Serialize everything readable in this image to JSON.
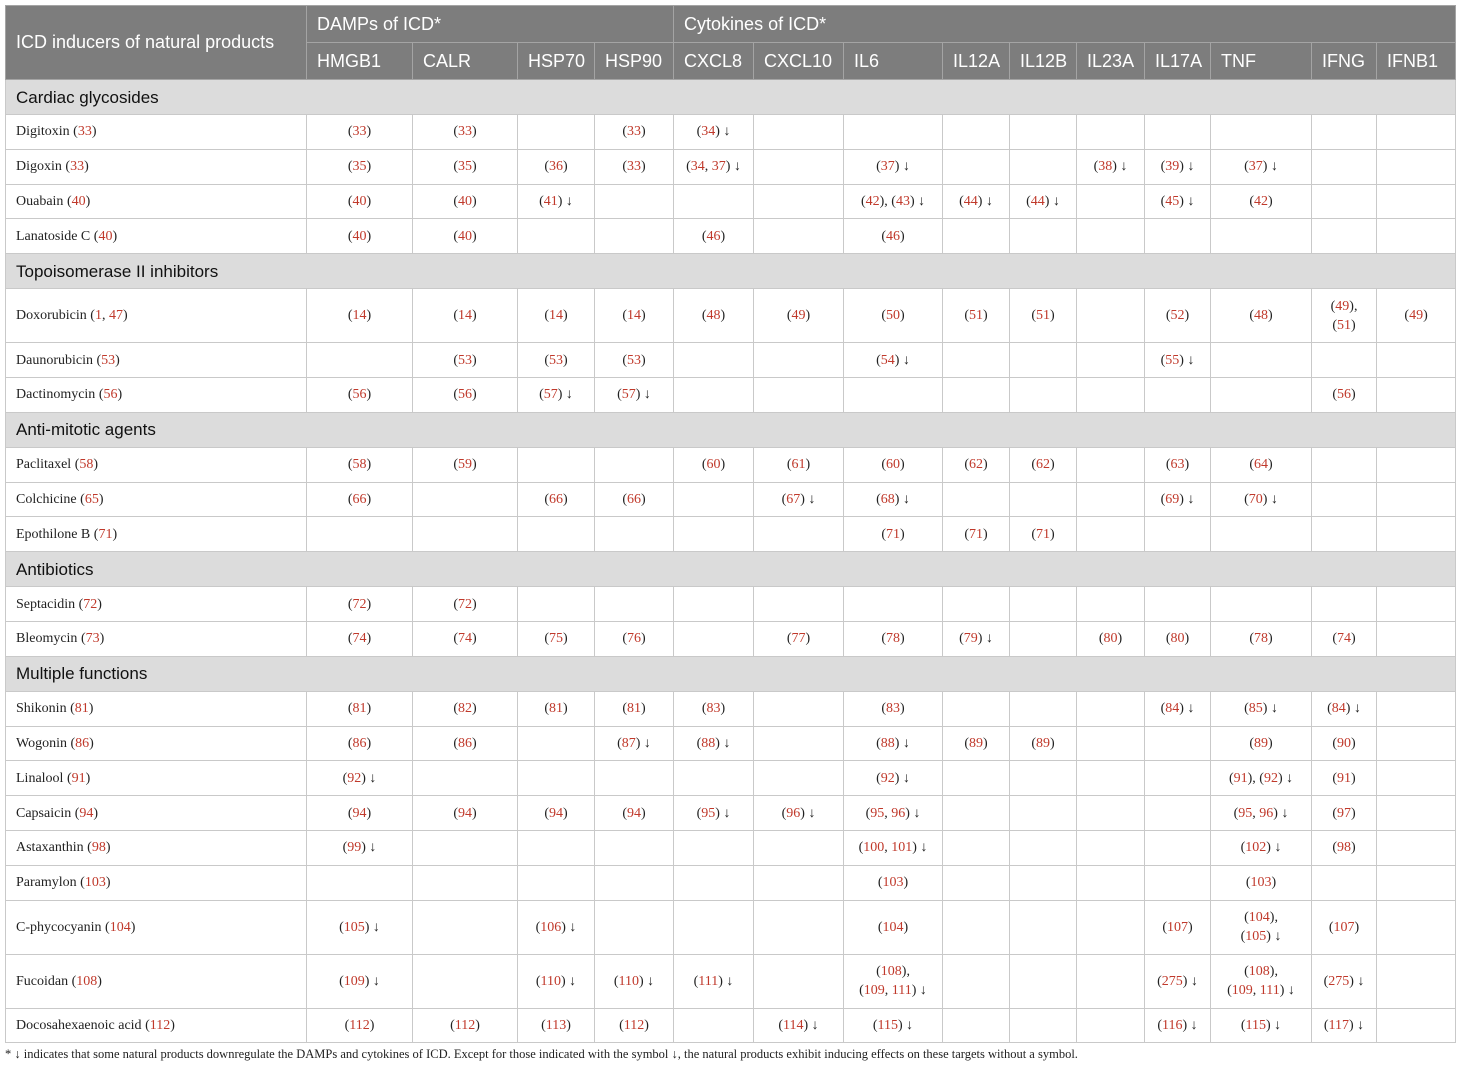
{
  "header": {
    "corner": "ICD inducers of natural products",
    "group_damps": "DAMPs of ICD*",
    "group_cytokines": "Cytokines of ICD*",
    "columns": [
      "HMGB1",
      "CALR",
      "HSP70",
      "HSP90",
      "CXCL8",
      "CXCL10",
      "IL6",
      "IL12A",
      "IL12B",
      "IL23A",
      "IL17A",
      "TNF",
      "IFNG",
      "IFNB1"
    ]
  },
  "colors": {
    "header_bg": "#7d7d7d",
    "group_bg": "#dcdcdc",
    "reference": "#c0392b",
    "grid": "#c9c9c9"
  },
  "sections": [
    {
      "title": "Cardiac glycosides",
      "rows": [
        {
          "name": "Digitoxin",
          "ref": "33",
          "cells": [
            "33",
            "33",
            "",
            "33",
            "34 ↓",
            "",
            "",
            "",
            "",
            "",
            "",
            "",
            "",
            ""
          ]
        },
        {
          "name": "Digoxin",
          "ref": "33",
          "cells": [
            "35",
            "35",
            "36",
            "33",
            "34, 37 ↓",
            "",
            "37 ↓",
            "",
            "",
            "38 ↓",
            "39 ↓",
            "37 ↓",
            "",
            ""
          ]
        },
        {
          "name": "Ouabain",
          "ref": "40",
          "cells": [
            "40",
            "40",
            "41 ↓",
            "",
            "",
            "",
            "42|43 ↓",
            "44 ↓",
            "44 ↓",
            "",
            "45 ↓",
            "42",
            "",
            ""
          ]
        },
        {
          "name": "Lanatoside C",
          "ref": "40",
          "cells": [
            "40",
            "40",
            "",
            "",
            "46",
            "",
            "46",
            "",
            "",
            "",
            "",
            "",
            "",
            ""
          ]
        }
      ]
    },
    {
      "title": "Topoisomerase II inhibitors",
      "rows": [
        {
          "name": "Doxorubicin",
          "ref": "1, 47",
          "cells": [
            "14",
            "14",
            "14",
            "14",
            "48",
            "49",
            "50",
            "51",
            "51",
            "",
            "52",
            "48",
            "49,|51",
            "49"
          ]
        },
        {
          "name": "Daunorubicin",
          "ref": "53",
          "cells": [
            "",
            "53",
            "53",
            "53",
            "",
            "",
            "54 ↓",
            "",
            "",
            "",
            "55 ↓",
            "",
            "",
            ""
          ]
        },
        {
          "name": "Dactinomycin",
          "ref": "56",
          "cells": [
            "56",
            "56",
            "57 ↓",
            "57 ↓",
            "",
            "",
            "",
            "",
            "",
            "",
            "",
            "",
            "56",
            ""
          ]
        }
      ]
    },
    {
      "title": "Anti-mitotic agents",
      "rows": [
        {
          "name": "Paclitaxel",
          "ref": "58",
          "cells": [
            "58",
            "59",
            "",
            "",
            "60",
            "61",
            "60",
            "62",
            "62",
            "",
            "63",
            "64",
            "",
            ""
          ]
        },
        {
          "name": "Colchicine",
          "ref": "65",
          "cells": [
            "66",
            "",
            "66",
            "66",
            "",
            "67 ↓",
            "68 ↓",
            "",
            "",
            "",
            "69 ↓",
            "70 ↓",
            "",
            ""
          ]
        },
        {
          "name": "Epothilone B",
          "ref": "71",
          "cells": [
            "",
            "",
            "",
            "",
            "",
            "",
            "71",
            "71",
            "71",
            "",
            "",
            "",
            "",
            ""
          ]
        }
      ]
    },
    {
      "title": "Antibiotics",
      "rows": [
        {
          "name": "Septacidin",
          "ref": "72",
          "cells": [
            "72",
            "72",
            "",
            "",
            "",
            "",
            "",
            "",
            "",
            "",
            "",
            "",
            "",
            ""
          ]
        },
        {
          "name": "Bleomycin",
          "ref": "73",
          "cells": [
            "74",
            "74",
            "75",
            "76",
            "",
            "77",
            "78",
            "79 ↓",
            "",
            "80",
            "80",
            "78",
            "74",
            ""
          ]
        }
      ]
    },
    {
      "title": "Multiple functions",
      "rows": [
        {
          "name": "Shikonin",
          "ref": "81",
          "cells": [
            "81",
            "82",
            "81",
            "81",
            "83",
            "",
            "83",
            "",
            "",
            "",
            "84 ↓",
            "85 ↓",
            "84 ↓",
            ""
          ]
        },
        {
          "name": "Wogonin",
          "ref": "86",
          "cells": [
            "86",
            "86",
            "",
            "87 ↓",
            "88 ↓",
            "",
            "88 ↓",
            "89",
            "89",
            "",
            "",
            "89",
            "90",
            ""
          ]
        },
        {
          "name": "Linalool",
          "ref": "91",
          "cells": [
            "92 ↓",
            "",
            "",
            "",
            "",
            "",
            "92 ↓",
            "",
            "",
            "",
            "",
            "91|92 ↓",
            "91",
            ""
          ]
        },
        {
          "name": "Capsaicin",
          "ref": "94",
          "cells": [
            "94",
            "94",
            "94",
            "94",
            "95 ↓",
            "96 ↓",
            "95, 96 ↓",
            "",
            "",
            "",
            "",
            "95, 96 ↓",
            "97",
            ""
          ]
        },
        {
          "name": "Astaxanthin",
          "ref": "98",
          "cells": [
            "99 ↓",
            "",
            "",
            "",
            "",
            "",
            "100, 101 ↓",
            "",
            "",
            "",
            "",
            "102 ↓",
            "98",
            ""
          ]
        },
        {
          "name": "Paramylon",
          "ref": "103",
          "cells": [
            "",
            "",
            "",
            "",
            "",
            "",
            "103",
            "",
            "",
            "",
            "",
            "103",
            "",
            ""
          ]
        },
        {
          "name": "C-phycocyanin",
          "ref": "104",
          "cells": [
            "105 ↓",
            "",
            "106 ↓",
            "",
            "",
            "",
            "104",
            "",
            "",
            "",
            "107",
            "104,|105 ↓",
            "107",
            ""
          ]
        },
        {
          "name": "Fucoidan",
          "ref": "108",
          "cells": [
            "109 ↓",
            "",
            "110 ↓",
            "110 ↓",
            "111 ↓",
            "",
            "108,|109, 111 ↓",
            "",
            "",
            "",
            "275 ↓",
            "108,|109, 111 ↓",
            "275 ↓",
            ""
          ]
        },
        {
          "name": "Docosahexaenoic acid",
          "ref": "112",
          "cells": [
            "112",
            "112",
            "113",
            "112",
            "",
            "114 ↓",
            "115 ↓",
            "",
            "",
            "",
            "116 ↓",
            "115 ↓",
            "117 ↓",
            ""
          ]
        }
      ]
    }
  ],
  "footnote": "* ↓ indicates that some natural products downregulate the DAMPs and cytokines of ICD. Except for those indicated with the symbol ↓, the natural products exhibit inducing effects on these targets without a symbol."
}
